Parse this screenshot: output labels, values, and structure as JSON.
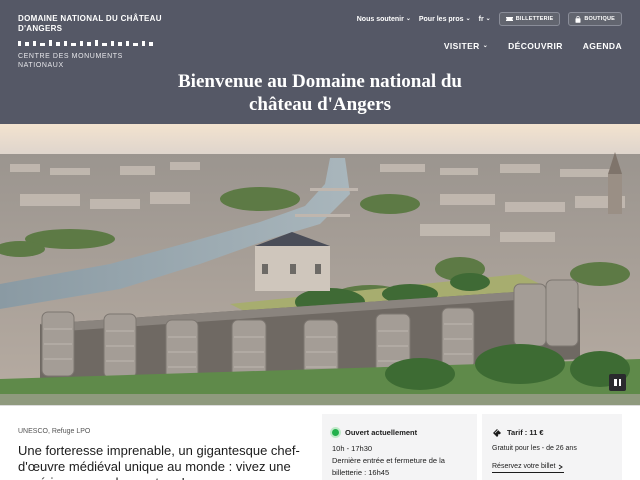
{
  "logo": {
    "title_line1": "DOMAINE NATIONAL DU CHÂTEAU",
    "title_line2": "D'ANGERS",
    "subtitle": "CENTRE DES MONUMENTS NATIONAUX"
  },
  "top_nav": {
    "nous_soutenir": "Nous soutenir",
    "pour_les_pros": "Pour les pros",
    "language": "fr",
    "billetterie": "BILLETTERIE",
    "boutique": "BOUTIQUE"
  },
  "main_nav": {
    "visiter": "VISITER",
    "decouvrir": "DÉCOUVRIR",
    "agenda": "AGENDA"
  },
  "hero": {
    "title_line1": "Bienvenue au Domaine national du",
    "title_line2": "château d'Angers"
  },
  "intro": {
    "tagline": "UNESCO, Refuge LPO",
    "headline": "Une forteresse imprenable, un gigantesque chef-d'œuvre médiéval unique au monde : vivez une expérience grandeur nature !"
  },
  "opening": {
    "status": "Ouvert actuellement",
    "hours": "10h - 17h30",
    "last_entry": "Dernière entrée et fermeture de la billetterie : 16h45"
  },
  "tarif": {
    "label": "Tarif : 11 €",
    "note": "Gratuit pour les - de 26 ans",
    "link": "Réservez votre billet"
  },
  "icons": {
    "pause": "pause-icon",
    "ticket": "ticket-icon",
    "bag": "bag-icon",
    "chevron": "chevron-down-icon",
    "arrow": "arrow-right-icon"
  },
  "colors": {
    "header_bg": "#555866",
    "status_green": "#22b04b",
    "panel_bg": "#f4f4f5"
  }
}
